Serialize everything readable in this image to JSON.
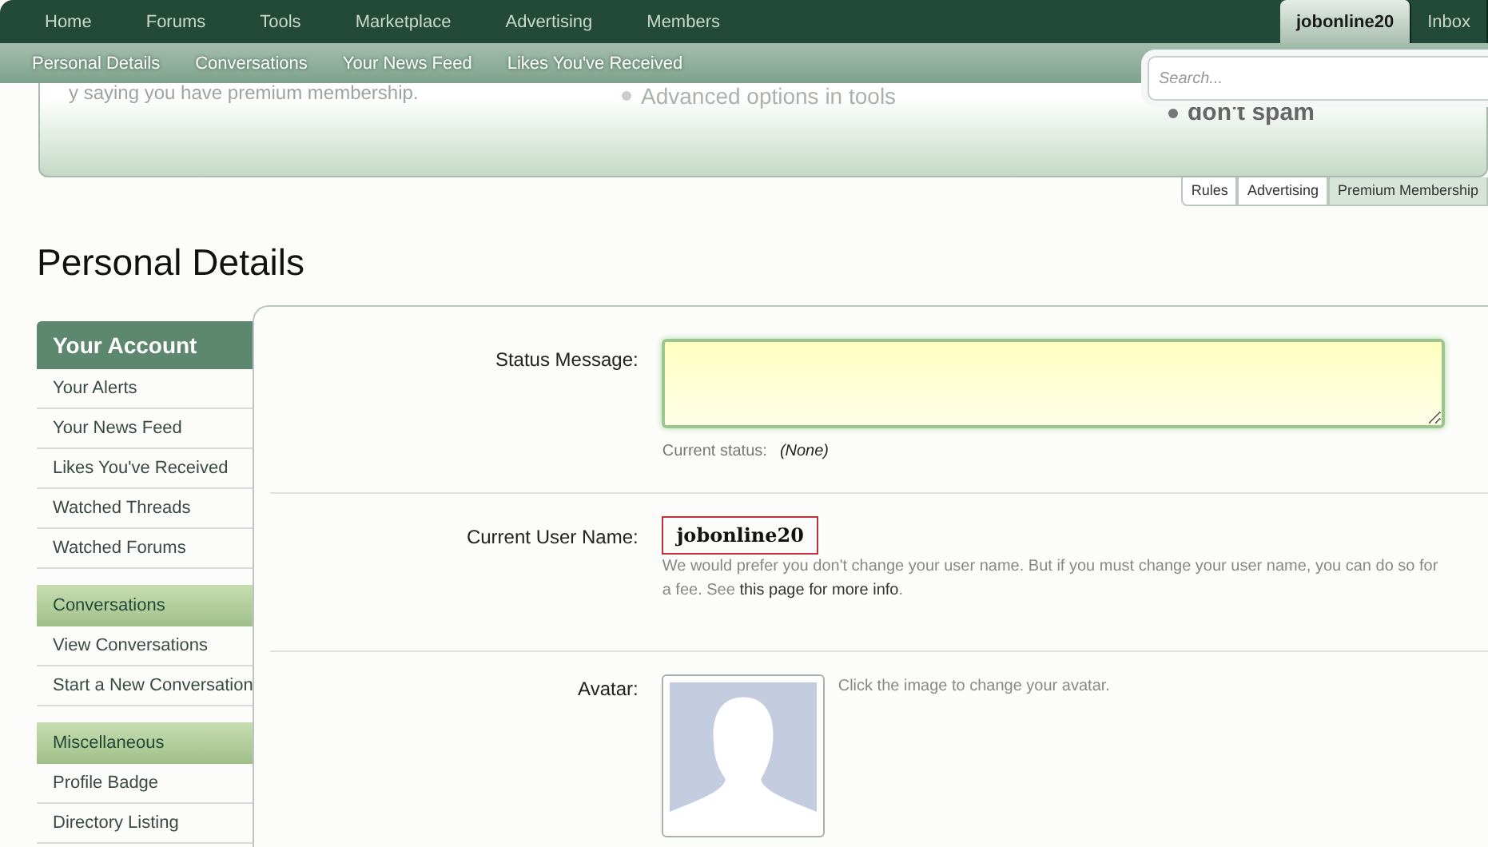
{
  "nav": {
    "items": [
      {
        "label": "Home",
        "selected": false
      },
      {
        "label": "Forums",
        "selected": false
      },
      {
        "label": "Tools",
        "selected": false
      },
      {
        "label": "Marketplace",
        "selected": false
      },
      {
        "label": "Advertising",
        "selected": false
      },
      {
        "label": "Members",
        "selected": false
      }
    ],
    "user_items": [
      {
        "label": "jobonline20",
        "selected": true
      },
      {
        "label": "Inbox",
        "selected": false
      }
    ]
  },
  "subnav": [
    "Personal Details",
    "Conversations",
    "Your News Feed",
    "Likes You've Received"
  ],
  "search": {
    "placeholder": "Search..."
  },
  "banner": {
    "text": "y saying you have premium membership.",
    "bullets": [
      {
        "text": "Advanced options in tools",
        "kind": "faded"
      },
      {
        "text": "don't spam",
        "kind": "bold"
      }
    ],
    "tabs": [
      {
        "label": "Rules",
        "selected": false
      },
      {
        "label": "Advertising",
        "selected": false
      },
      {
        "label": "Premium Membership",
        "selected": true
      }
    ]
  },
  "title": "Personal Details",
  "sidebar": [
    {
      "heading": "Your Account",
      "kind": "main",
      "items": [
        "Your Alerts",
        "Your News Feed",
        "Likes You've Received",
        "Watched Threads",
        "Watched Forums"
      ]
    },
    {
      "heading": "Conversations",
      "kind": "sub",
      "items": [
        "View Conversations",
        "Start a New Conversation"
      ]
    },
    {
      "heading": "Miscellaneous",
      "kind": "sub",
      "items": [
        "Profile Badge",
        "Directory Listing"
      ]
    }
  ],
  "form": {
    "status": {
      "label": "Status Message:",
      "current_label": "Current status:",
      "current_value": "(None)"
    },
    "username": {
      "label": "Current User Name:",
      "value": "jobonline20",
      "hint": "We would prefer you don't change your user name. But if you must change your user name, you can do so for a fee. See",
      "link": "this page for more info",
      "after": "."
    },
    "avatar": {
      "label": "Avatar:",
      "hint": "Click the image to change your avatar."
    }
  }
}
